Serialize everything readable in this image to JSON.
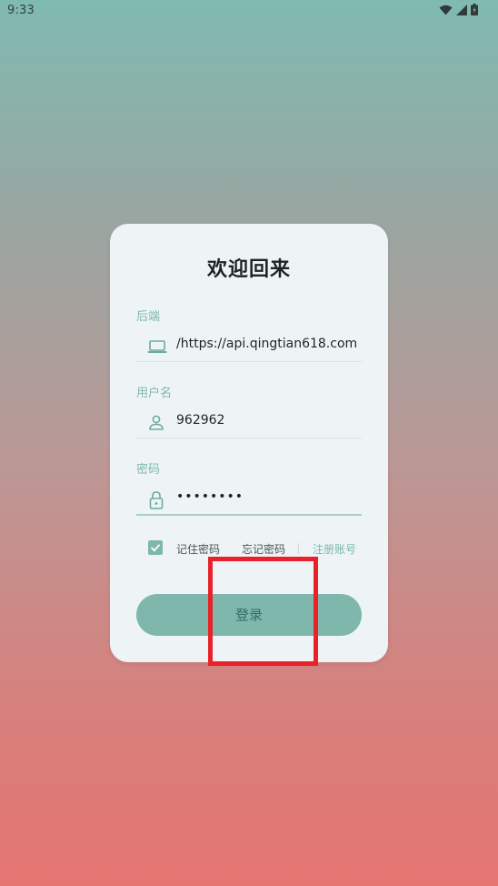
{
  "status_bar": {
    "time": "9:33",
    "icons": [
      "wifi-icon",
      "signal-icon",
      "battery-icon"
    ]
  },
  "login": {
    "title": "欢迎回来",
    "backend": {
      "label": "后端",
      "value": "https://api.qingtian618.com/",
      "icon": "laptop-icon"
    },
    "username": {
      "label": "用户名",
      "value": "962962",
      "icon": "person-icon"
    },
    "password": {
      "label": "密码",
      "value": "••••••••",
      "icon": "lock-icon"
    },
    "remember": {
      "label": "记住密码",
      "checked": true
    },
    "forgot_label": "忘记密码",
    "register_label": "注册账号",
    "login_label": "登录"
  },
  "colors": {
    "accent": "#7fb7ad",
    "highlight": "#e8212a",
    "card_bg": "#eef4f6"
  }
}
